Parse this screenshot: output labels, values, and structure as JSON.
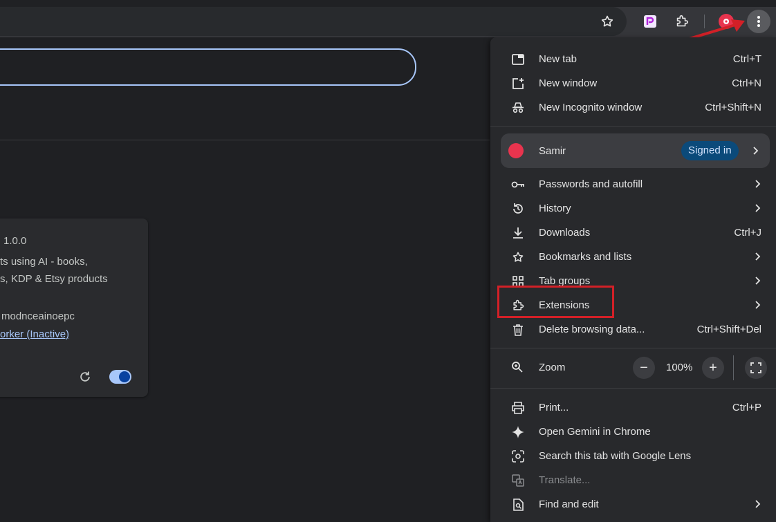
{
  "colors": {
    "menu_bg": "#28292c",
    "toolbar_bg": "#35363a",
    "page_bg": "#1f2023",
    "accent": "#a8c7fa",
    "highlight_red": "#d32027",
    "badge_bg": "#0b4a7a"
  },
  "toolbar": {
    "icons": [
      "star-icon",
      "extension-app-icon",
      "puzzle-icon",
      "profile-avatar-icon",
      "more-vert-icon"
    ]
  },
  "extension_card": {
    "version": "1.0.0",
    "desc_line1": "ts using AI - books,",
    "desc_line2": "s, KDP & Etsy products",
    "id_text": "modnceainoepc",
    "link_text": "orker (Inactive)",
    "enabled": true
  },
  "menu": {
    "new_tab": {
      "label": "New tab",
      "shortcut": "Ctrl+T"
    },
    "new_window": {
      "label": "New window",
      "shortcut": "Ctrl+N"
    },
    "incognito": {
      "label": "New Incognito window",
      "shortcut": "Ctrl+Shift+N"
    },
    "profile": {
      "name": "Samir",
      "badge": "Signed in"
    },
    "passwords": {
      "label": "Passwords and autofill"
    },
    "history": {
      "label": "History"
    },
    "downloads": {
      "label": "Downloads",
      "shortcut": "Ctrl+J"
    },
    "bookmarks": {
      "label": "Bookmarks and lists"
    },
    "tab_groups": {
      "label": "Tab groups"
    },
    "extensions": {
      "label": "Extensions"
    },
    "delete_data": {
      "label": "Delete browsing data...",
      "shortcut": "Ctrl+Shift+Del"
    },
    "zoom": {
      "label": "Zoom",
      "value": "100%",
      "minus": "−",
      "plus": "+"
    },
    "print": {
      "label": "Print...",
      "shortcut": "Ctrl+P"
    },
    "gemini": {
      "label": "Open Gemini in Chrome"
    },
    "lens": {
      "label": "Search this tab with Google Lens"
    },
    "translate": {
      "label": "Translate..."
    },
    "find_edit": {
      "label": "Find and edit"
    }
  }
}
